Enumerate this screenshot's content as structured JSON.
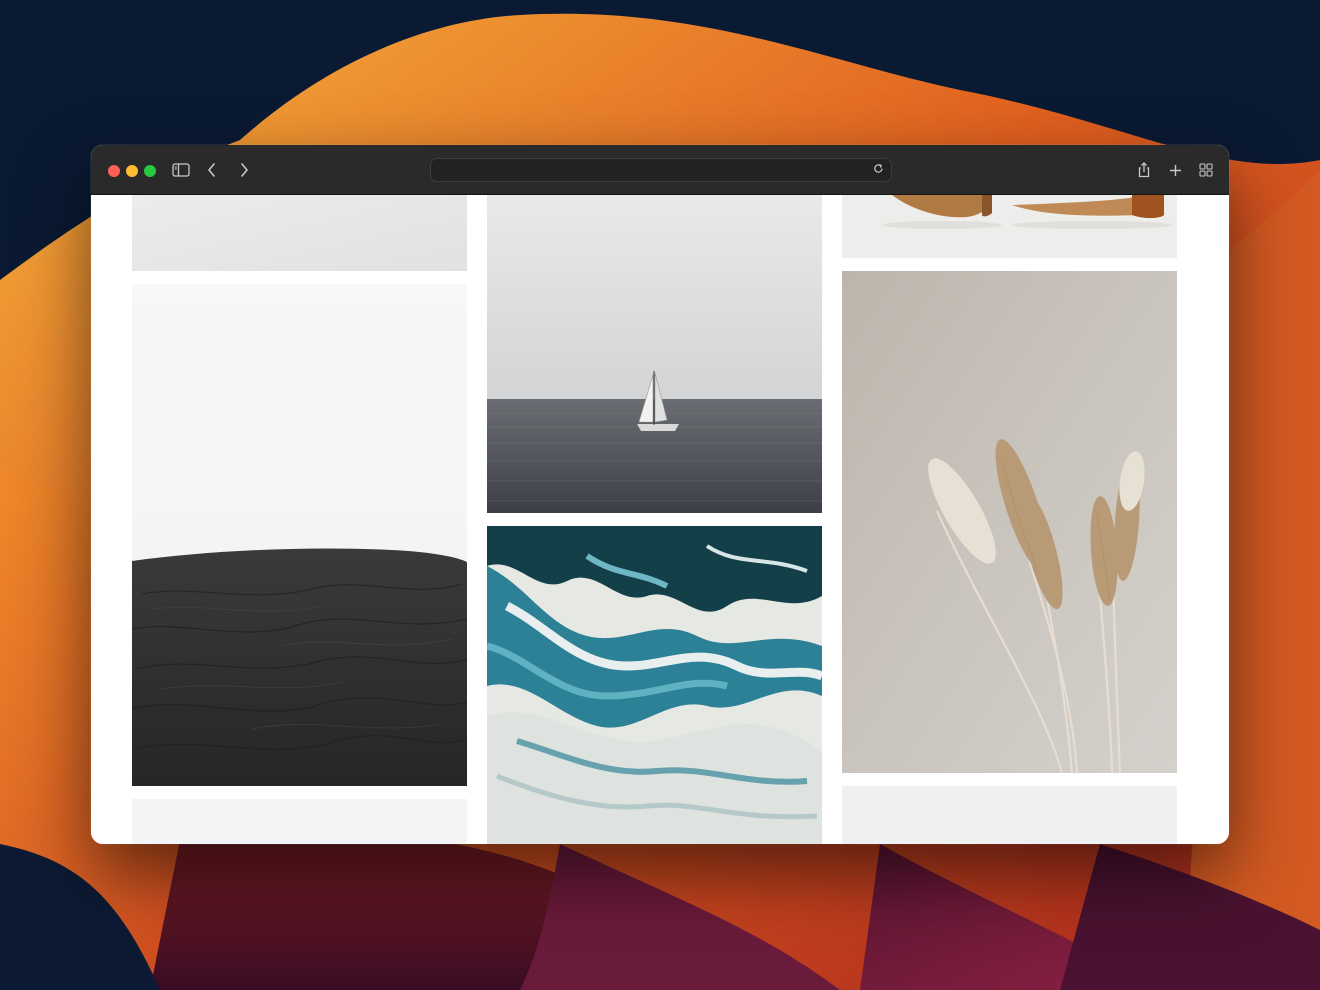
{
  "window": {
    "address_value": "",
    "address_placeholder": ""
  },
  "icons": {
    "sidebar": "sidebar-toggle-icon",
    "back": "chevron-left-icon",
    "forward": "chevron-right-icon",
    "reload": "reload-icon",
    "share": "share-icon",
    "new_tab": "plus-icon",
    "tab_overview": "grid-icon"
  },
  "colors": {
    "titlebar": "#2b2a2a",
    "close": "#fe5f57",
    "minimize": "#febc2e",
    "maximize": "#28c840",
    "page": "#ffffff"
  },
  "gallery": {
    "tiles": [
      {
        "subject": "white-surface",
        "alt": ""
      },
      {
        "subject": "black-dune",
        "alt": ""
      },
      {
        "subject": "light-gray",
        "alt": ""
      },
      {
        "subject": "sailboat-sea",
        "alt": ""
      },
      {
        "subject": "teal-marble",
        "alt": ""
      },
      {
        "subject": "wooden-objects",
        "alt": ""
      },
      {
        "subject": "pampas-grass",
        "alt": ""
      },
      {
        "subject": "light-gray",
        "alt": ""
      }
    ]
  }
}
